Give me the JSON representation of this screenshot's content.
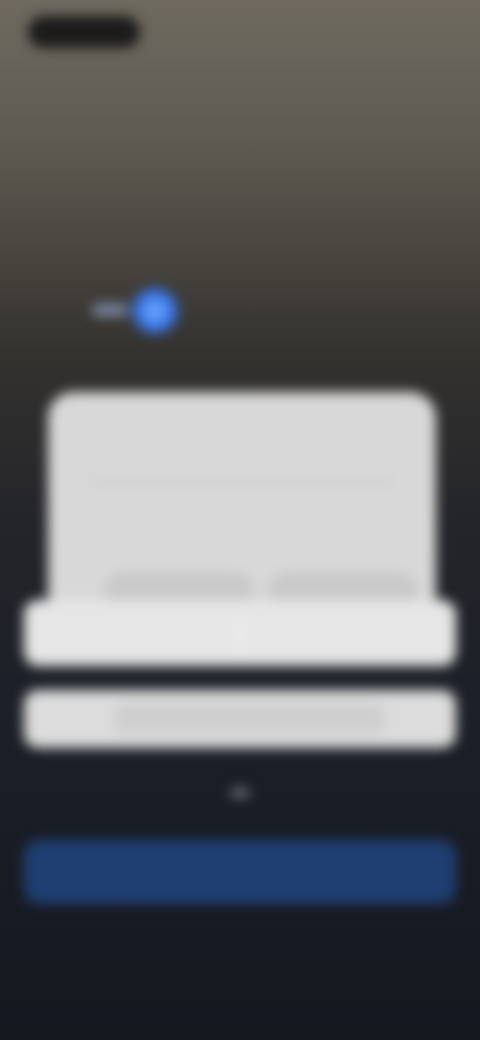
{
  "status_bar": {
    "time": ""
  },
  "header": {
    "brand_name": "",
    "brand_icon": "brand-logo-icon"
  },
  "dialog": {
    "title": "",
    "body": "",
    "left_button": "",
    "right_button": ""
  },
  "sheet": {
    "option_a": "",
    "option_b": "",
    "cancel": ""
  },
  "buttons": {
    "primary": "",
    "secondary": ""
  },
  "colors": {
    "primary_button": "#1f3e72",
    "dialog_bg": "#d8d8d8",
    "sheet_bg": "#e6e6e6",
    "accent_blue": "#3d7ef0"
  }
}
